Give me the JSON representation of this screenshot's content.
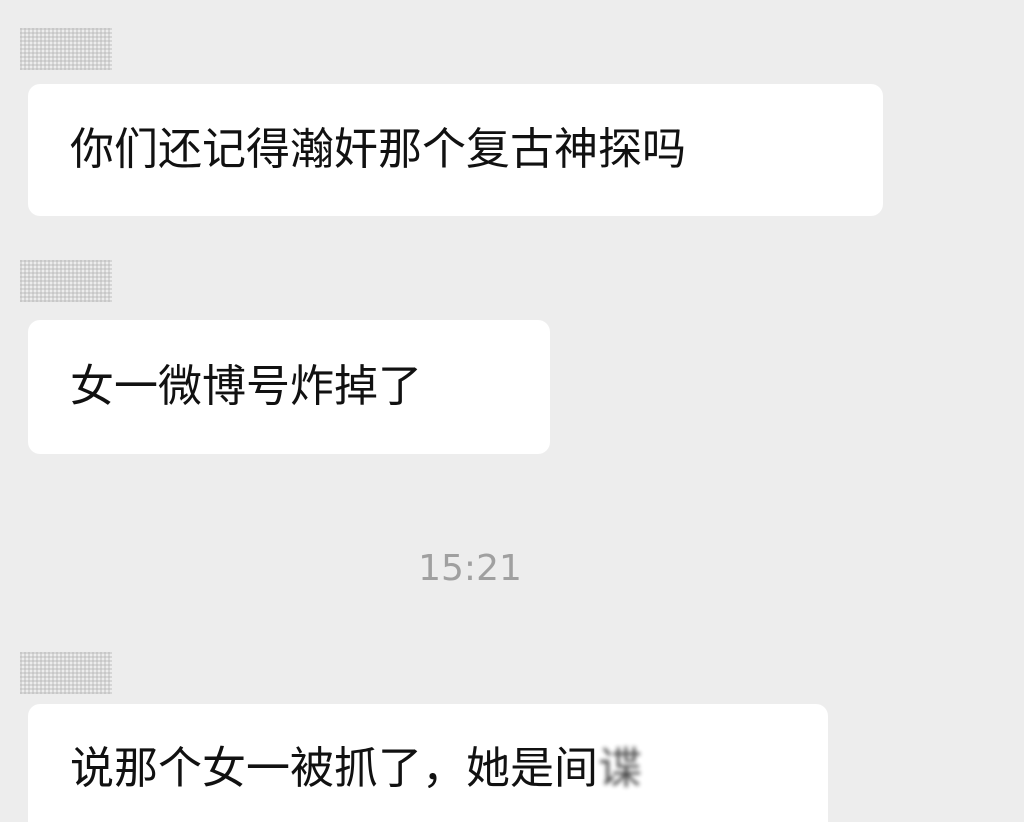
{
  "messages": [
    {
      "text": "你们还记得瀚奸那个复古神探吗"
    },
    {
      "text": "女一微博号炸掉了"
    },
    {
      "timestamp": "15:21"
    },
    {
      "text": "说那个女一被抓了，她是间",
      "obscured_tail": "谍"
    }
  ]
}
